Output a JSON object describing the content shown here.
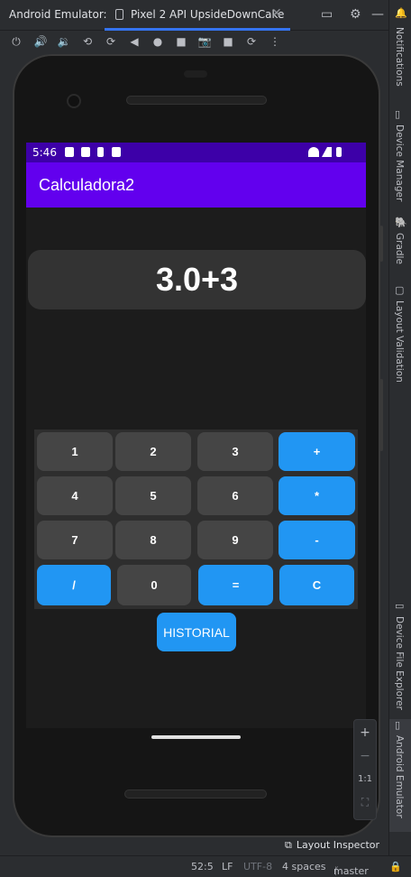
{
  "ide": {
    "app_title": "Android Emulator:",
    "tab_label": "Pixel 2 API UpsideDownCake",
    "tab_close": "✕",
    "window_buttons": {
      "restore": "▭",
      "settings": "⚙",
      "minimize": "—"
    }
  },
  "toolbar": {
    "icons": [
      "power-icon",
      "volume-up-icon",
      "volume-down-icon",
      "rotate-left-icon",
      "rotate-right-icon",
      "back-icon",
      "home-icon",
      "overview-icon",
      "screenshot-icon",
      "screen-record-icon",
      "snapshot-icon",
      "more-icon"
    ],
    "glyphs": {
      "power": "⏻",
      "vol_up": "🔊",
      "vol_down": "🔉",
      "rot_left": "⟲",
      "rot_right": "⟳",
      "back": "◀",
      "home": "●",
      "overview": "■",
      "camera": "📷",
      "record": "■",
      "snapshot": "⟳",
      "more": "⋮"
    }
  },
  "right_rail": {
    "notifications": "Notifications",
    "device_manager": "Device Manager",
    "gradle": "Gradle",
    "layout_validation": "Layout Validation",
    "device_file_explorer": "Device File Explorer",
    "android_emulator": "Android Emulator"
  },
  "zoom_panel": {
    "zoom_in": "+",
    "zoom_out": "−",
    "one_to_one": "1:1",
    "fit": "⛶"
  },
  "layout_inspector": "Layout Inspector",
  "statusbar": {
    "position": "52:5",
    "line_sep": "LF",
    "encoding": "UTF-8",
    "indent": "4 spaces",
    "branch": "master"
  },
  "device": {
    "status_time": "5:46",
    "app_title": "Calculadora2",
    "display": "3.0+3",
    "keys": [
      [
        "1",
        "2",
        "3",
        "+"
      ],
      [
        "4",
        "5",
        "6",
        "*"
      ],
      [
        "7",
        "8",
        "9",
        "-"
      ],
      [
        "/",
        "0",
        "=",
        "C"
      ]
    ],
    "historial": "HISTORIAL"
  },
  "colors": {
    "status_bar": "#3d00a8",
    "app_bar": "#6200ee",
    "accent_button": "#2196f3",
    "number_button": "#454545",
    "display_bg": "#333333",
    "ide_bg": "#2b2d30"
  }
}
